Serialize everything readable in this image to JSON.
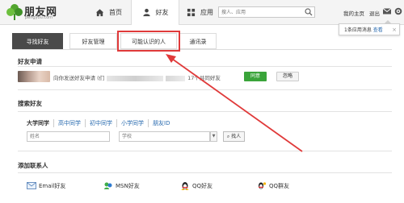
{
  "header": {
    "logo_name": "朋友网",
    "logo_url": "pengyou.com",
    "nav": [
      {
        "label": "首页"
      },
      {
        "label": "好友"
      },
      {
        "label": "应用"
      }
    ],
    "search_placeholder": "搜人、应用",
    "links": {
      "my_home": "我的主页",
      "logout": "退出"
    }
  },
  "notification": {
    "text": "1条应用消息",
    "link": "查看",
    "close": "×"
  },
  "tabs": [
    {
      "label": "寻找好友",
      "active": true
    },
    {
      "label": "好友管理",
      "active": false
    },
    {
      "label": "可能认识的人",
      "active": false
    },
    {
      "label": "通讯录",
      "active": false
    }
  ],
  "friend_requests": {
    "title": "好友申请",
    "text_a": "向你发送好友申请 (们",
    "text_b": "17个共同好友",
    "agree_label": "同意",
    "ignore_label": "忽略"
  },
  "search_friends": {
    "title": "搜索好友",
    "tabs": [
      "大学同学",
      "高中同学",
      "初中同学",
      "小学同学",
      "朋友ID"
    ],
    "name_placeholder": "姓名",
    "school_placeholder": "学校",
    "find_label": "找人"
  },
  "add_contacts": {
    "title": "添加联系人",
    "items": [
      "Email好友",
      "MSN好友",
      "QQ好友",
      "QQ群友"
    ]
  },
  "colors": {
    "accent_green": "#3aa43a",
    "highlight_red": "#e03a3a",
    "active_tab": "#4a4a4a"
  }
}
